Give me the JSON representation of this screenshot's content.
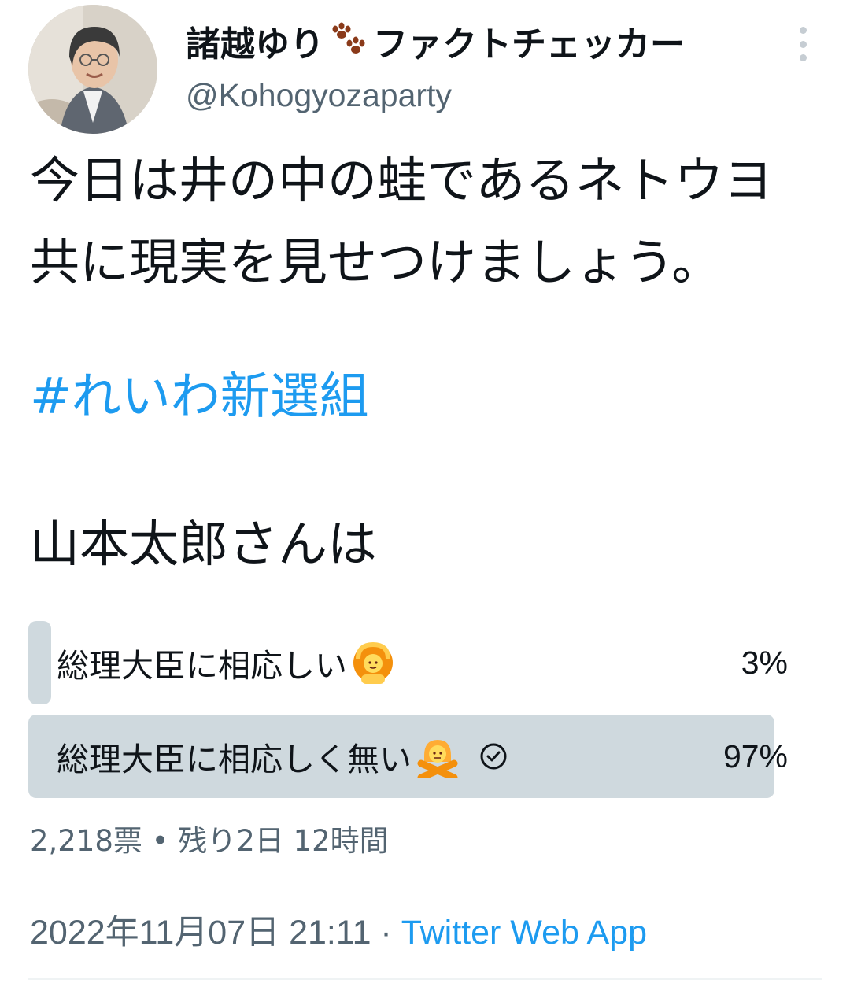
{
  "author": {
    "display_name": "諸越ゆり",
    "name_suffix": "ファクトチェッカー",
    "handle": "@Kohogyozaparty"
  },
  "tweet": {
    "text": "今日は井の中の蛙であるネトウヨ共に現実を見せつけましょう。",
    "hashtag": "#れいわ新選組",
    "question": "山本太郎さんは"
  },
  "poll": {
    "options": [
      {
        "label": "総理大臣に相応しい",
        "percent": "3%",
        "share": 0.03,
        "emoji": "person-gesturing-ok",
        "selected": false
      },
      {
        "label": "総理大臣に相応しく無い",
        "percent": "97%",
        "share": 0.97,
        "emoji": "person-gesturing-no",
        "selected": true
      }
    ],
    "meta": "2,218票 • 残り2日 12時間"
  },
  "footer": {
    "timestamp": "2022年11月07日 21:11 ·",
    "source": "Twitter Web App"
  },
  "colors": {
    "text": "#0f1419",
    "secondary": "#536471",
    "link": "#1d9bf0",
    "poll_bar": "#cfd9de"
  }
}
